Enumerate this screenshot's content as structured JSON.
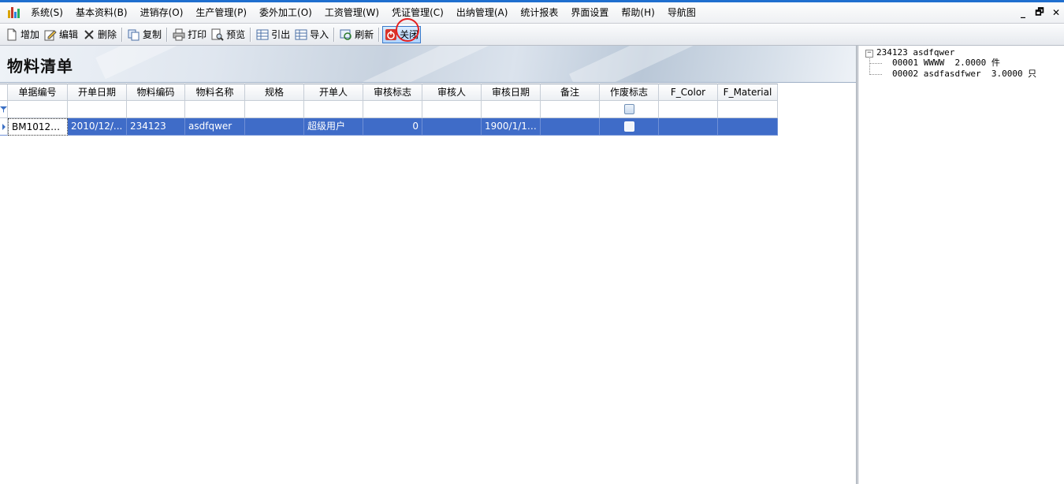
{
  "menu": {
    "items": [
      "系统(S)",
      "基本资料(B)",
      "进销存(O)",
      "生产管理(P)",
      "委外加工(O)",
      "工资管理(W)",
      "凭证管理(C)",
      "出纳管理(A)",
      "统计报表",
      "界面设置",
      "帮助(H)",
      "导航图"
    ],
    "window_buttons": {
      "minimize": "_",
      "restore": "🗗",
      "close": "✕"
    }
  },
  "toolbar": {
    "add": "增加",
    "edit": "编辑",
    "delete": "删除",
    "copy": "复制",
    "print": "打印",
    "preview": "预览",
    "export": "引出",
    "import": "导入",
    "refresh": "刷新",
    "close": "关闭"
  },
  "page": {
    "title": "物料清单"
  },
  "grid": {
    "columns": [
      "单据编号",
      "开单日期",
      "物料编码",
      "物料名称",
      "规格",
      "开单人",
      "审核标志",
      "审核人",
      "审核日期",
      "备注",
      "作废标志",
      "F_Color",
      "F_Material"
    ],
    "rows": [
      {
        "doc_no": "BM10122...",
        "date": "2010/12/...",
        "material_code": "234123",
        "material_name": "asdfqwer",
        "spec": "",
        "creator": "超级用户",
        "audit_flag": "0",
        "auditor": "",
        "audit_date": "1900/1/1 ...",
        "remark": "",
        "void_flag": false,
        "f_color": "",
        "f_material": ""
      }
    ]
  },
  "tree": {
    "root": {
      "expander": "−",
      "label": "234123 asdfqwer"
    },
    "children": [
      {
        "label": "00001 WWWW  2.0000 件"
      },
      {
        "label": "00002 asdfasdfwer  3.0000 只"
      }
    ]
  },
  "colors": {
    "accent": "#1f6fcf",
    "selection": "#3f6cc8",
    "highlight_ring": "#e32020"
  }
}
